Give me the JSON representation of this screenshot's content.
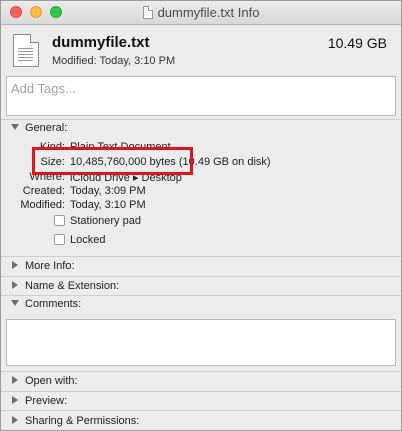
{
  "window": {
    "title": "dummyfile.txt Info"
  },
  "header": {
    "file_name": "dummyfile.txt",
    "file_size": "10.49 GB",
    "modified": "Modified: Today, 3:10 PM"
  },
  "tags": {
    "placeholder": "Add Tags..."
  },
  "general": {
    "label": "General:",
    "kind_label": "Kind:",
    "kind_value": "Plain Text Document",
    "size_label": "Size:",
    "size_value": "10,485,760,000 bytes (10.49 GB on disk)",
    "where_label": "Where:",
    "where_value": "iCloud Drive ▸ Desktop",
    "created_label": "Created:",
    "created_value": "Today, 3:09 PM",
    "modified_label": "Modified:",
    "modified_value": "Today, 3:10 PM",
    "stationery_label": "Stationery pad",
    "locked_label": "Locked"
  },
  "sections": {
    "more_info": "More Info:",
    "name_extension": "Name & Extension:",
    "comments": "Comments:",
    "open_with": "Open with:",
    "preview": "Preview:",
    "sharing": "Sharing & Permissions:"
  },
  "colors": {
    "highlight": "#e0141e"
  }
}
